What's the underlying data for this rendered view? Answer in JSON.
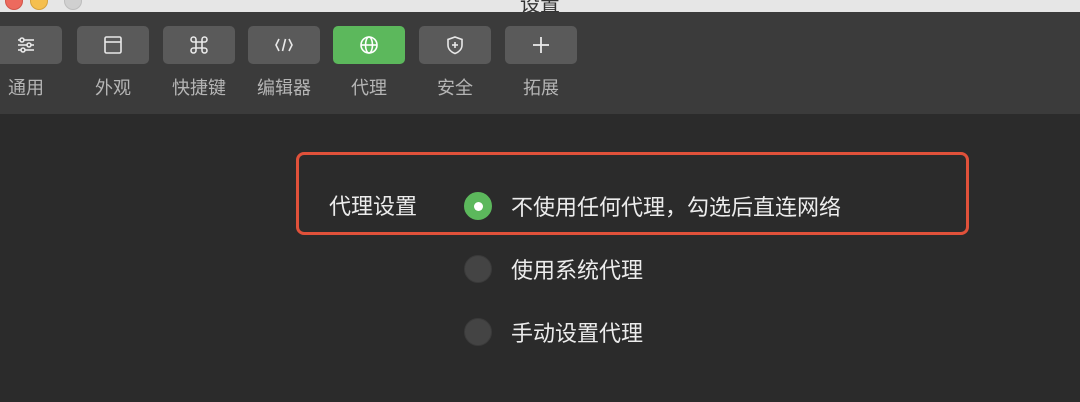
{
  "window": {
    "title": "设置"
  },
  "toolbar": {
    "items": [
      {
        "label": "通用",
        "icon": "sliders-icon",
        "active": false
      },
      {
        "label": "外观",
        "icon": "window-icon",
        "active": false
      },
      {
        "label": "快捷键",
        "icon": "command-icon",
        "active": false
      },
      {
        "label": "编辑器",
        "icon": "code-icon",
        "active": false
      },
      {
        "label": "代理",
        "icon": "globe-icon",
        "active": true
      },
      {
        "label": "安全",
        "icon": "shield-icon",
        "active": false
      },
      {
        "label": "拓展",
        "icon": "plus-icon",
        "active": false
      }
    ]
  },
  "proxy": {
    "section_label": "代理设置",
    "options": [
      {
        "label": "不使用任何代理，勾选后直连网络",
        "checked": true
      },
      {
        "label": "使用系统代理",
        "checked": false
      },
      {
        "label": "手动设置代理",
        "checked": false
      }
    ]
  },
  "colors": {
    "accent_green": "#5cb85c",
    "highlight_red": "#e0513a",
    "background": "#2b2b2b",
    "toolbar": "#3b3b3b"
  }
}
